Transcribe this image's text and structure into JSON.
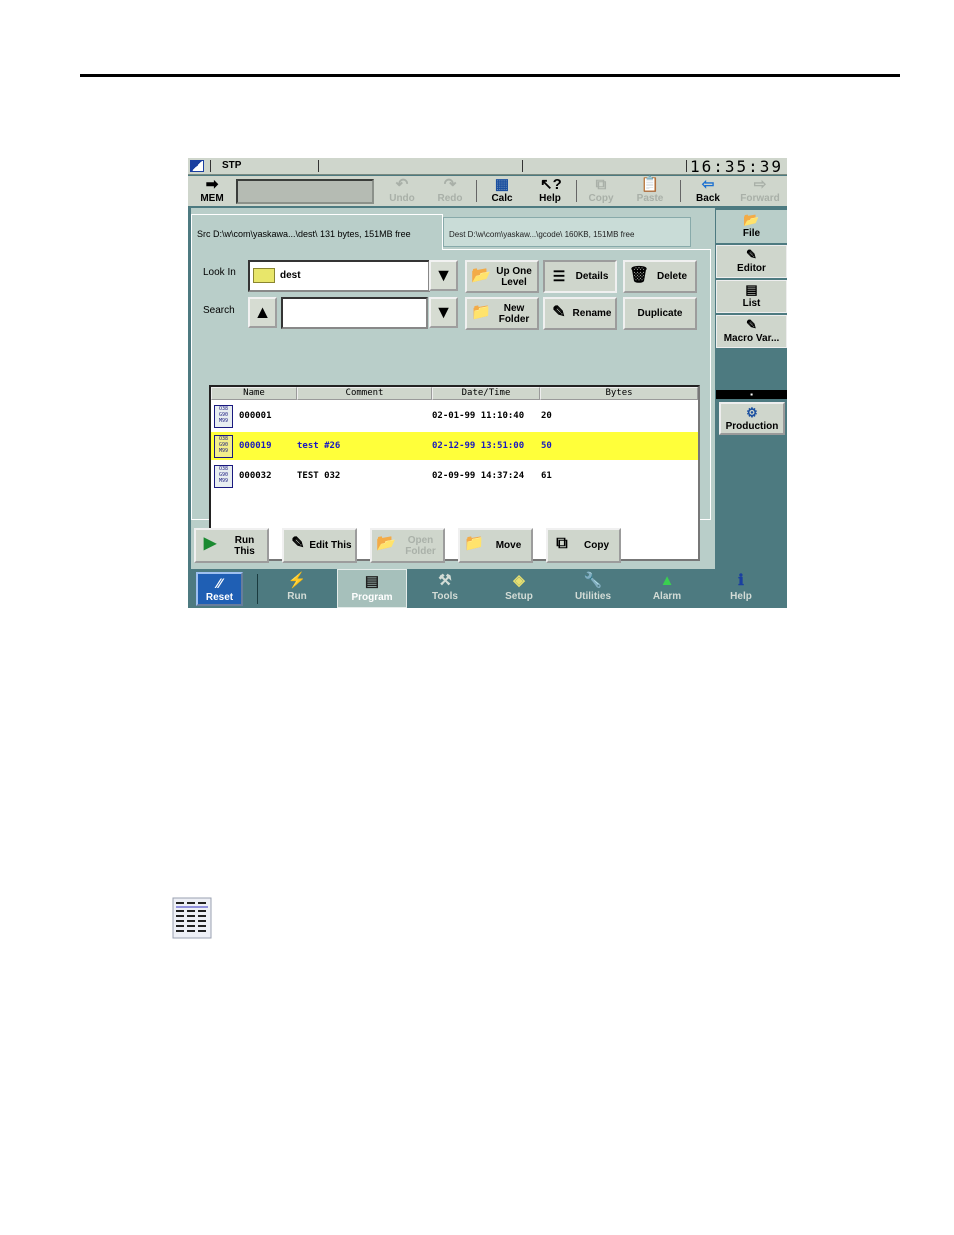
{
  "status": {
    "mode": "STP",
    "clock": "16:35:39"
  },
  "toolbar": {
    "mem_label": "MEM",
    "buttons": [
      {
        "label": "Undo",
        "icon": "undo-icon",
        "enabled": false
      },
      {
        "label": "Redo",
        "icon": "redo-icon",
        "enabled": false
      },
      {
        "label": "Calc",
        "icon": "calculator-icon",
        "enabled": true
      },
      {
        "label": "Help",
        "icon": "help-cursor-icon",
        "enabled": true
      },
      {
        "label": "Copy",
        "icon": "copy-icon",
        "enabled": false
      },
      {
        "label": "Paste",
        "icon": "paste-icon",
        "enabled": false
      },
      {
        "label": "Back",
        "icon": "back-arrow-icon",
        "enabled": true
      },
      {
        "label": "Forward",
        "icon": "forward-arrow-icon",
        "enabled": false
      }
    ]
  },
  "tabs": {
    "src": "Src D:\\w\\com\\yaskawa...\\dest\\    131 bytes, 151MB free",
    "dest": "Dest D:\\w\\com\\yaskaw...\\gcode\\    160KB, 151MB free"
  },
  "lookin": {
    "label": "Look In",
    "value": "dest"
  },
  "search": {
    "label": "Search",
    "value": ""
  },
  "buttons": {
    "up_one_level": "Up One Level",
    "details": "Details",
    "delete": "Delete",
    "new_folder": "New Folder",
    "rename": "Rename",
    "duplicate": "Duplicate"
  },
  "columns": [
    "Name",
    "Comment",
    "Date/Time",
    "Bytes"
  ],
  "files": [
    {
      "name": "000001",
      "comment": "",
      "datetime": "02-01-99 11:10:40",
      "bytes": "20",
      "selected": false
    },
    {
      "name": "000019",
      "comment": "test #26",
      "datetime": "02-12-99 13:51:00",
      "bytes": "50",
      "selected": true
    },
    {
      "name": "000032",
      "comment": "TEST 032",
      "datetime": "02-09-99 14:37:24",
      "bytes": "61",
      "selected": false
    }
  ],
  "file_icon_text": "O38\nG90\nM99",
  "actions": {
    "run_this": "Run This",
    "edit_this": "Edit This",
    "open_folder": "Open Folder",
    "move": "Move",
    "copy": "Copy"
  },
  "side": {
    "file": "File",
    "editor": "Editor",
    "list": "List",
    "macro": "Macro Var...",
    "production": "Production"
  },
  "nav": {
    "reset": "Reset",
    "items": [
      "Run",
      "Program",
      "Tools",
      "Setup",
      "Utilities",
      "Alarm",
      "Help"
    ],
    "selected": "Program"
  },
  "colors": {
    "selection": "#ffff3a",
    "selection_text": "#1a1ac0",
    "frame": "#4d7a80",
    "panel": "#b9cec9",
    "reset": "#1f5fb4"
  }
}
